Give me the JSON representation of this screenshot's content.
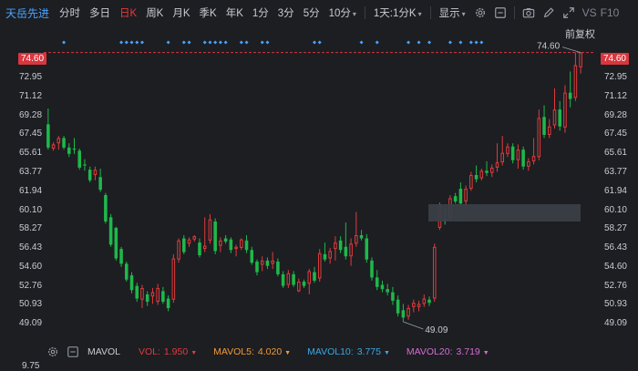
{
  "toolbar": {
    "stock_name": "天岳先进",
    "tabs": [
      "分时",
      "多日",
      "日K",
      "周K",
      "月K",
      "季K",
      "年K",
      "1分",
      "3分",
      "5分"
    ],
    "active_tab": "日K",
    "dropdown_10": "10分",
    "dropdown_1d": "1天:1分K",
    "dropdown_display": "显示",
    "vs": "VS",
    "f10": "F10"
  },
  "adjust_label": "前复权",
  "price_axis": {
    "ticks": [
      "72.95",
      "71.12",
      "69.28",
      "67.45",
      "65.61",
      "63.77",
      "61.94",
      "60.10",
      "58.27",
      "56.43",
      "54.60",
      "52.76",
      "50.93",
      "49.09"
    ],
    "current_price": "74.60",
    "high_annotation": "74.60",
    "low_annotation": "49.09"
  },
  "indicator": {
    "name": "MAVOL",
    "vol_label": "VOL:",
    "vol_value": "1.950",
    "mavol5_label": "MAVOL5:",
    "mavol5_value": "4.020",
    "mavol10_label": "MAVOL10:",
    "mavol10_value": "3.775",
    "mavol20_label": "MAVOL20:",
    "mavol20_value": "3.719",
    "axis_value": "9.75"
  },
  "colors": {
    "up": "#e23b3b",
    "down": "#1fb84a",
    "vol": "#e23b3b",
    "mavol5": "#f29b38",
    "mavol10": "#3da6e0",
    "mavol20": "#d86bd6",
    "marker": "#4aa3ff"
  },
  "chart_data": {
    "type": "candlestick",
    "y_range": [
      48.5,
      75.6
    ],
    "candles": [
      [
        67.8,
        69.3,
        65.4,
        65.6
      ],
      [
        65.5,
        66.1,
        65.3,
        65.9
      ],
      [
        66.0,
        66.7,
        65.4,
        66.5
      ],
      [
        66.5,
        66.7,
        65.4,
        65.6
      ],
      [
        65.6,
        66.0,
        64.7,
        65.0
      ],
      [
        65.5,
        66.5,
        65.0,
        65.4
      ],
      [
        65.3,
        65.5,
        63.5,
        63.7
      ],
      [
        64.0,
        64.5,
        63.4,
        63.9
      ],
      [
        63.5,
        63.8,
        62.3,
        62.5
      ],
      [
        63.0,
        63.8,
        62.5,
        63.5
      ],
      [
        62.8,
        63.6,
        61.4,
        61.6
      ],
      [
        61.1,
        61.3,
        58.4,
        58.6
      ],
      [
        59.0,
        59.3,
        56.2,
        56.4
      ],
      [
        58.0,
        58.1,
        54.9,
        55.1
      ],
      [
        56.0,
        56.2,
        54.3,
        54.6
      ],
      [
        54.6,
        54.8,
        52.9,
        53.1
      ],
      [
        53.5,
        53.8,
        51.8,
        52.1
      ],
      [
        52.5,
        52.8,
        51.0,
        51.3
      ],
      [
        51.2,
        52.6,
        50.4,
        52.3
      ],
      [
        51.7,
        52.0,
        50.6,
        51.0
      ],
      [
        51.5,
        52.3,
        50.8,
        51.9
      ],
      [
        51.0,
        52.7,
        50.7,
        52.3
      ],
      [
        52.0,
        52.4,
        50.8,
        51.0
      ],
      [
        51.3,
        51.6,
        50.1,
        50.4
      ],
      [
        51.2,
        55.5,
        50.9,
        55.1
      ],
      [
        55.0,
        57.0,
        54.7,
        56.8
      ],
      [
        57.0,
        57.3,
        55.5,
        55.7
      ],
      [
        56.5,
        57.1,
        56.2,
        56.9
      ],
      [
        56.9,
        57.3,
        56.7,
        57.2
      ],
      [
        56.6,
        57.0,
        55.2,
        55.4
      ],
      [
        56.0,
        59.0,
        55.7,
        56.3
      ],
      [
        56.8,
        59.3,
        56.5,
        58.8
      ],
      [
        58.6,
        58.9,
        55.5,
        55.8
      ],
      [
        56.3,
        57.1,
        55.7,
        56.8
      ],
      [
        57.0,
        57.3,
        56.5,
        56.7
      ],
      [
        56.9,
        57.1,
        55.6,
        55.9
      ],
      [
        56.0,
        56.4,
        55.3,
        56.2
      ],
      [
        56.1,
        57.0,
        55.9,
        56.9
      ],
      [
        56.8,
        57.3,
        55.6,
        55.9
      ],
      [
        55.9,
        56.2,
        54.5,
        54.7
      ],
      [
        54.8,
        55.0,
        53.5,
        53.8
      ],
      [
        54.5,
        55.3,
        53.9,
        54.9
      ],
      [
        54.9,
        55.2,
        54.1,
        54.4
      ],
      [
        54.6,
        55.7,
        54.1,
        54.9
      ],
      [
        54.8,
        55.1,
        53.4,
        53.6
      ],
      [
        53.6,
        53.9,
        52.3,
        52.5
      ],
      [
        52.6,
        54.0,
        52.3,
        53.7
      ],
      [
        53.6,
        53.9,
        52.4,
        52.6
      ],
      [
        52.0,
        53.2,
        51.9,
        52.9
      ],
      [
        52.9,
        53.1,
        52.3,
        52.5
      ],
      [
        52.7,
        54.1,
        51.7,
        53.9
      ],
      [
        53.8,
        54.3,
        52.8,
        53.0
      ],
      [
        53.2,
        56.0,
        52.9,
        55.6
      ],
      [
        55.5,
        56.6,
        54.8,
        55.0
      ],
      [
        55.1,
        56.1,
        54.6,
        55.8
      ],
      [
        56.0,
        57.2,
        54.9,
        56.6
      ],
      [
        56.8,
        57.2,
        55.6,
        55.9
      ],
      [
        56.2,
        58.5,
        55.0,
        55.3
      ],
      [
        55.3,
        57.0,
        54.4,
        56.5
      ],
      [
        56.5,
        59.5,
        56.2,
        57.3
      ],
      [
        57.3,
        57.8,
        56.8,
        57.0
      ],
      [
        57.0,
        57.4,
        54.7,
        55.0
      ],
      [
        54.9,
        55.2,
        53.0,
        53.3
      ],
      [
        53.3,
        54.0,
        52.1,
        52.4
      ],
      [
        52.6,
        53.0,
        51.9,
        52.2
      ],
      [
        52.2,
        52.7,
        51.6,
        51.9
      ],
      [
        51.9,
        52.4,
        50.7,
        51.1
      ],
      [
        51.2,
        51.6,
        49.6,
        49.9
      ],
      [
        50.2,
        50.8,
        49.1,
        49.5
      ],
      [
        49.6,
        50.7,
        49.3,
        50.4
      ],
      [
        50.5,
        51.2,
        50.0,
        50.9
      ],
      [
        50.5,
        51.1,
        50.1,
        50.8
      ],
      [
        50.8,
        51.7,
        50.5,
        51.3
      ],
      [
        51.2,
        51.5,
        50.6,
        50.9
      ],
      [
        51.3,
        56.5,
        51.0,
        56.2
      ],
      [
        58.0,
        60.4,
        57.8,
        60.2
      ],
      [
        58.8,
        59.8,
        58.3,
        58.6
      ],
      [
        59.0,
        61.1,
        58.7,
        60.8
      ],
      [
        61.0,
        61.3,
        60.3,
        60.5
      ],
      [
        61.7,
        62.3,
        60.0,
        60.3
      ],
      [
        60.5,
        62.0,
        60.0,
        61.7
      ],
      [
        61.7,
        63.3,
        61.5,
        63.0
      ],
      [
        63.0,
        63.9,
        62.3,
        62.6
      ],
      [
        62.7,
        63.6,
        62.5,
        63.4
      ],
      [
        63.4,
        64.3,
        62.9,
        63.2
      ],
      [
        63.2,
        64.0,
        62.8,
        63.7
      ],
      [
        63.7,
        66.0,
        63.3,
        64.2
      ],
      [
        64.2,
        66.7,
        63.9,
        65.1
      ],
      [
        65.0,
        66.0,
        64.7,
        65.7
      ],
      [
        65.7,
        66.0,
        64.1,
        64.4
      ],
      [
        64.4,
        65.9,
        63.6,
        65.4
      ],
      [
        65.4,
        65.7,
        63.5,
        63.8
      ],
      [
        63.8,
        64.6,
        63.4,
        64.3
      ],
      [
        64.3,
        66.5,
        64.0,
        64.8
      ],
      [
        64.7,
        69.2,
        64.4,
        68.4
      ],
      [
        68.5,
        69.6,
        66.5,
        66.8
      ],
      [
        66.8,
        68.3,
        66.5,
        67.6
      ],
      [
        67.7,
        71.2,
        67.4,
        69.2
      ],
      [
        69.2,
        70.0,
        67.2,
        67.6
      ],
      [
        67.5,
        71.5,
        67.0,
        70.8
      ],
      [
        70.8,
        72.8,
        69.4,
        70.2
      ],
      [
        70.3,
        74.6,
        70.0,
        73.4
      ],
      [
        73.2,
        74.6,
        72.6,
        74.6
      ]
    ]
  }
}
